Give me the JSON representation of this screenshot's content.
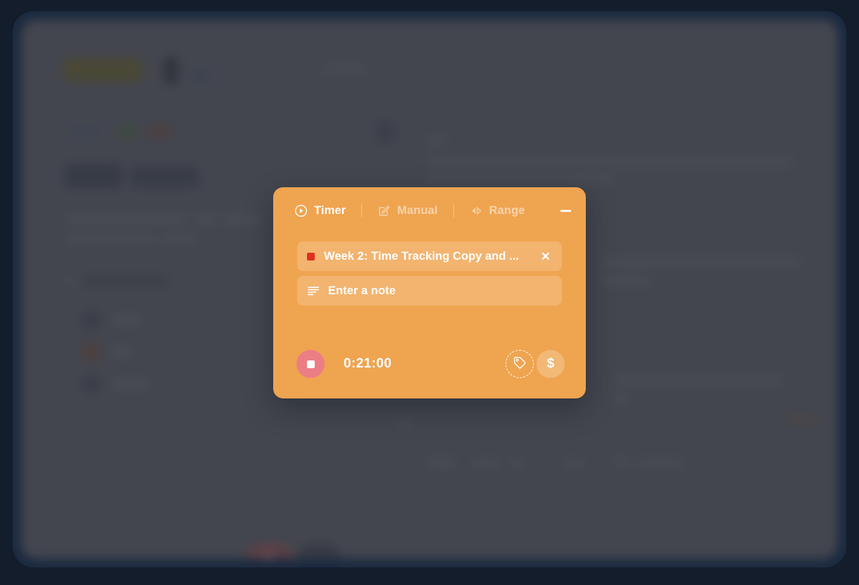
{
  "window": {
    "background_color": "#141d2c",
    "panel_color": "#43464e"
  },
  "background_app": {
    "page_title": "Task View",
    "description": "blurred task view page behind modal"
  },
  "timer_popup": {
    "accent_color": "#efa450",
    "tabs": [
      {
        "id": "timer",
        "label": "Timer",
        "icon": "play-circle-icon",
        "active": true
      },
      {
        "id": "manual",
        "label": "Manual",
        "icon": "pencil-square-icon",
        "active": false
      },
      {
        "id": "range",
        "label": "Range",
        "icon": "arrows-left-right-icon",
        "active": false
      }
    ],
    "minimize_icon": "minimize-icon",
    "task": {
      "name": "Week 2: Time Tracking Copy and ...",
      "color": "#e03020",
      "remove_label": "✕"
    },
    "note": {
      "placeholder": "Enter a note",
      "icon": "note-lines-icon",
      "value": ""
    },
    "footer": {
      "stop_icon": "stop-square-icon",
      "stop_color": "#eb7e85",
      "elapsed_time": "0:21:00",
      "tag_icon": "tag-icon",
      "billable_label": "$"
    }
  }
}
